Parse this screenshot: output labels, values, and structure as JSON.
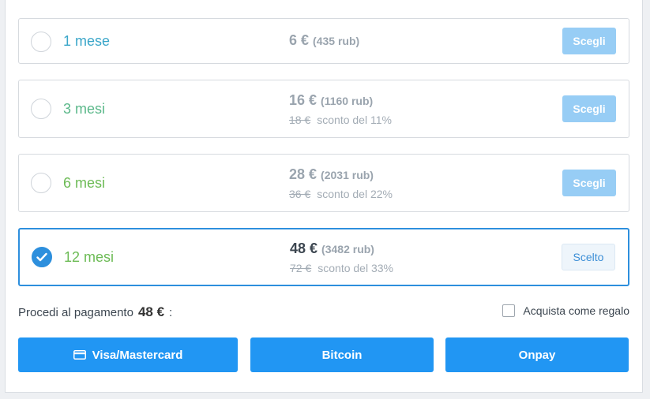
{
  "plans": [
    {
      "name": "1 mese",
      "price": "6 €",
      "rub": "(435 rub)",
      "old_price": "",
      "discount": "",
      "button": "Scegli",
      "name_color": "#3aa6c9"
    },
    {
      "name": "3 mesi",
      "price": "16 €",
      "rub": "(1160 rub)",
      "old_price": "18 €",
      "discount": "sconto del 11%",
      "button": "Scegli",
      "name_color": "#5bb88a"
    },
    {
      "name": "6 mesi",
      "price": "28 €",
      "rub": "(2031 rub)",
      "old_price": "36 €",
      "discount": "sconto del 22%",
      "button": "Scegli",
      "name_color": "#6cbb55"
    },
    {
      "name": "12 mesi",
      "price": "48 €",
      "rub": "(3482 rub)",
      "old_price": "72 €",
      "discount": "sconto del 33%",
      "button": "Scelto",
      "name_color": "#6cbb55"
    }
  ],
  "checkout": {
    "label": "Procedi al pagamento",
    "amount": "48 €",
    "suffix": ":",
    "gift_label": "Acquista come regalo"
  },
  "payment_methods": [
    {
      "label": "Visa/Mastercard",
      "icon": "credit-card-icon"
    },
    {
      "label": "Bitcoin"
    },
    {
      "label": "Onpay"
    }
  ],
  "colors": {
    "accent": "#2196f3",
    "selected_border": "#2d8fdd",
    "button_disabled": "#97cdf5"
  }
}
